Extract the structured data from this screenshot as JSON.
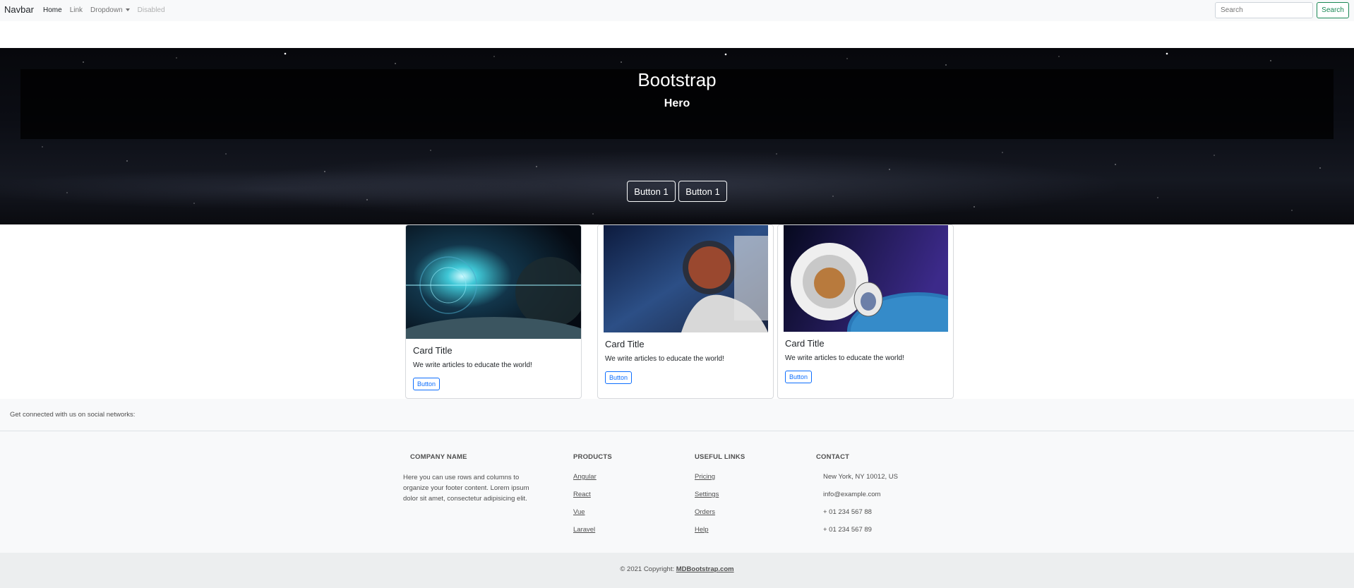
{
  "navbar": {
    "brand": "Navbar",
    "links": [
      {
        "label": "Home",
        "state": "active"
      },
      {
        "label": "Link",
        "state": "normal"
      },
      {
        "label": "Dropdown",
        "state": "dropdown"
      },
      {
        "label": "Disabled",
        "state": "disabled"
      }
    ],
    "search_placeholder": "Search",
    "search_button": "Search"
  },
  "hero": {
    "title": "Bootstrap",
    "subtitle": "Hero",
    "buttons": [
      "Button 1",
      "Button 1"
    ]
  },
  "cards": [
    {
      "title": "Card Title",
      "text": "We write articles to educate the world!",
      "button": "Button",
      "image": "space-planets-image"
    },
    {
      "title": "Card Title",
      "text": "We write articles to educate the world!",
      "button": "Button",
      "image": "astronaut-image"
    },
    {
      "title": "Card Title",
      "text": "We write articles to educate the world!",
      "button": "Button",
      "image": "cat-astronaut-image"
    }
  ],
  "footer": {
    "social_text": "Get connected with us on social networks:",
    "company": {
      "heading": "COMPANY NAME",
      "lines": [
        "Here you can use rows and columns to",
        "organize your footer content. Lorem ipsum",
        "dolor sit amet, consectetur adipisicing elit."
      ]
    },
    "products": {
      "heading": "PRODUCTS",
      "links": [
        "Angular",
        "React",
        "Vue",
        "Laravel"
      ]
    },
    "useful_links": {
      "heading": "USEFUL LINKS",
      "links": [
        "Pricing",
        "Settings",
        "Orders",
        "Help"
      ]
    },
    "contact": {
      "heading": "CONTACT",
      "items": [
        "New York, NY 10012, US",
        "info@example.com",
        "+ 01 234 567 88",
        "+ 01 234 567 89"
      ]
    },
    "copyright_prefix": "© 2021 Copyright:",
    "copyright_link": "MDBootstrap.com"
  },
  "colors": {
    "primary": "#0d6efd",
    "success": "#198754",
    "footer_bg": "#f8f9fa",
    "copyright_bg": "#eceeef"
  }
}
